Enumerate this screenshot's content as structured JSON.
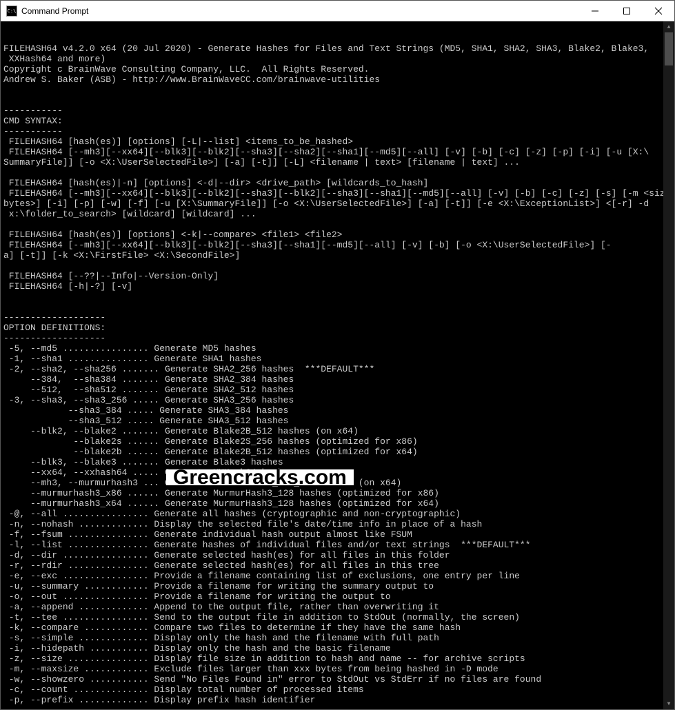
{
  "window": {
    "title": "Command Prompt",
    "icon_label": "C:\\"
  },
  "terminal": {
    "header": [
      "FILEHASH64 v4.2.0 x64 (20 Jul 2020) - Generate Hashes for Files and Text Strings (MD5, SHA1, SHA2, SHA3, Blake2, Blake3,",
      " XXHash64 and more)",
      "Copyright c BrainWave Consulting Company, LLC.  All Rights Reserved.",
      "Andrew S. Baker (ASB) - http://www.BrainWaveCC.com/brainwave-utilities",
      "",
      "",
      "-----------",
      "CMD SYNTAX:",
      "-----------",
      " FILEHASH64 [hash(es)] [options] [-L|--list] <items_to_be_hashed>",
      " FILEHASH64 [--mh3][--xx64][--blk3][--blk2][--sha3][--sha2][--sha1][--md5][--all] [-v] [-b] [-c] [-z] [-p] [-i] [-u [X:\\",
      "SummaryFile]] [-o <X:\\UserSelectedFile>] [-a] [-t]] [-L] <filename | text> [filename | text] ...",
      "",
      " FILEHASH64 [hash(es)|-n] [options] <-d|--dir> <drive_path> [wildcards_to_hash]",
      " FILEHASH64 [--mh3][--xx64][--blk3][--blk2][--sha3][--blk2][--sha3][--sha1][--md5][--all] [-v] [-b] [-c] [-z] [-s] [-m <size_in_",
      "bytes>] [-i] [-p] [-w] [-f] [-u [X:\\SummaryFile]] [-o <X:\\UserSelectedFile>] [-a] [-t]] [-e <X:\\ExceptionList>] <[-r] -d",
      " x:\\folder_to_search> [wildcard] [wildcard] ...",
      "",
      " FILEHASH64 [hash(es)] [options] <-k|--compare> <file1> <file2>",
      " FILEHASH64 [--mh3][--xx64][--blk3][--blk2][--sha3][--sha1][--md5][--all] [-v] [-b] [-o <X:\\UserSelectedFile>] [-",
      "a] [-t]] [-k <X:\\FirstFile> <X:\\SecondFile>]",
      "",
      " FILEHASH64 [--??|--Info|--Version-Only]",
      " FILEHASH64 [-h|-?] [-v]",
      "",
      "",
      "-------------------",
      "OPTION DEFINITIONS:",
      "-------------------"
    ],
    "options": [
      " -5, --md5 ................ Generate MD5 hashes",
      " -1, --sha1 ............... Generate SHA1 hashes",
      " -2, --sha2, --sha256 ....... Generate SHA2_256 hashes  ***DEFAULT***",
      "     --384,  --sha384 ....... Generate SHA2_384 hashes",
      "     --512,  --sha512 ....... Generate SHA2_512 hashes",
      " -3, --sha3, --sha3_256 ..... Generate SHA3_256 hashes",
      "            --sha3_384 ..... Generate SHA3_384 hashes",
      "            --sha3_512 ..... Generate SHA3_512 hashes",
      "     --blk2, --blake2 ....... Generate Blake2B_512 hashes (on x64)",
      "             --blake2s ...... Generate Blake2S_256 hashes (optimized for x86)",
      "             --blake2b ...... Generate Blake2B_512 hashes (optimized for x64)",
      "     --blk3, --blake3 ....... Generate Blake3 hashes",
      "     --xx64, --xxhash64 ..... Generate XXHash64 hashes",
      "     --mh3, --murmurhash3 ... Generate MurmurHash3_x64_128 hashes (on x64)",
      "     --murmurhash3_x86 ...... Generate MurmurHash3_128 hashes (optimized for x86)",
      "     --murmurhash3_x64 ...... Generate MurmurHash3_128 hashes (optimized for x64)",
      " -@, --all ................ Generate all hashes (cryptographic and non-cryptographic)",
      " -n, --nohash ............. Display the selected file's date/time info in place of a hash",
      " -f, --fsum ............... Generate individual hash output almost like FSUM",
      " -l, --list ............... Generate hashes of individual files and/or text strings  ***DEFAULT***",
      " -d, --dir ................ Generate selected hash(es) for all files in this folder",
      " -r, --rdir ............... Generate selected hash(es) for all files in this tree",
      " -e, --exc ................ Provide a filename containing list of exclusions, one entry per line",
      " -u, --summary ............ Provide a filename for writing the summary output to",
      " -o, --out ................ Provide a filename for writing the output to",
      " -a, --append ............. Append to the output file, rather than overwriting it",
      " -t, --tee ................ Send to the output file in addition to StdOut (normally, the screen)",
      " -k, --compare ............ Compare two files to determine if they have the same hash",
      " -s, --simple ............. Display only the hash and the filename with full path",
      " -i, --hidepath ........... Display only the hash and the basic filename",
      " -z, --size ............... Display file size in addition to hash and name -- for archive scripts",
      " -m, --maxsize ............ Exclude files larger than xxx bytes from being hashed in -D mode",
      " -w, --showzero ........... Send \"No Files Found in\" error to StdOut vs StdErr if no files are found",
      " -c, --count .............. Display total number of processed items",
      " -p, --prefix ............. Display prefix hash identifier"
    ]
  },
  "watermark": {
    "text": "Greencracks.com"
  }
}
